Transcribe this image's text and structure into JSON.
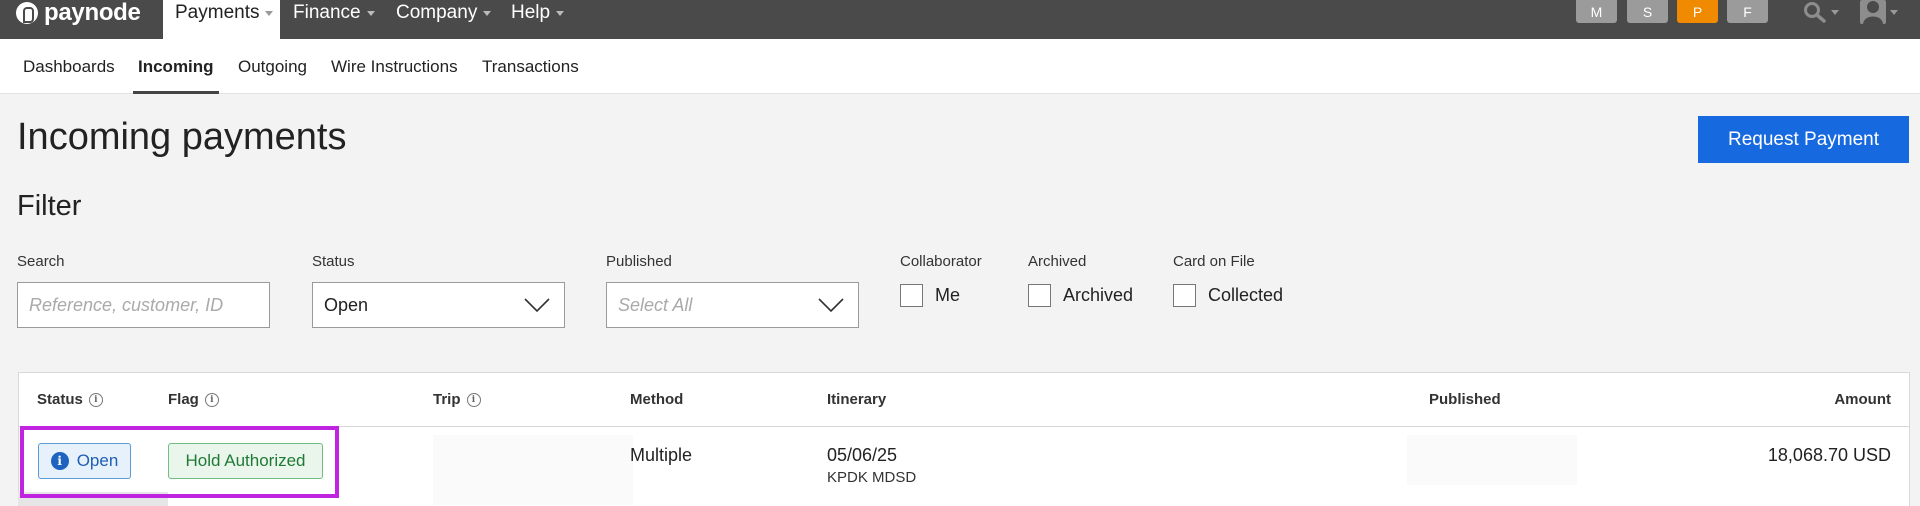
{
  "app": {
    "name": "paynode"
  },
  "topnav": {
    "items": [
      {
        "label": "Payments",
        "active": true
      },
      {
        "label": "Finance",
        "active": false
      },
      {
        "label": "Company",
        "active": false
      },
      {
        "label": "Help",
        "active": false
      }
    ],
    "avatars": [
      {
        "letter": "M",
        "color": "#9b9b9b"
      },
      {
        "letter": "S",
        "color": "#9b9b9b"
      },
      {
        "letter": "P",
        "color": "#f08a00"
      },
      {
        "letter": "F",
        "color": "#9b9b9b"
      }
    ],
    "icons": [
      "search-icon",
      "user-icon"
    ]
  },
  "subnav": {
    "tabs": [
      {
        "label": "Dashboards",
        "active": false
      },
      {
        "label": "Incoming",
        "active": true
      },
      {
        "label": "Outgoing",
        "active": false
      },
      {
        "label": "Wire Instructions",
        "active": false
      },
      {
        "label": "Transactions",
        "active": false
      }
    ]
  },
  "page": {
    "title": "Incoming payments",
    "request_button": "Request Payment",
    "accent": "#1769e0"
  },
  "filter": {
    "title": "Filter",
    "search": {
      "label": "Search",
      "placeholder": "Reference, customer, ID",
      "value": ""
    },
    "status": {
      "label": "Status",
      "value": "Open"
    },
    "published": {
      "label": "Published",
      "placeholder": "Select All"
    },
    "collaborator": {
      "label": "Collaborator",
      "option": "Me",
      "checked": false
    },
    "archived": {
      "label": "Archived",
      "option": "Archived",
      "checked": false
    },
    "card_on_file": {
      "label": "Card on File",
      "option": "Collected",
      "checked": false
    }
  },
  "table": {
    "columns": [
      "Status",
      "Flag",
      "Trip",
      "Method",
      "Itinerary",
      "Published",
      "Amount"
    ],
    "rows": [
      {
        "status": "Open",
        "flag": "Hold Authorized",
        "method": "Multiple",
        "itinerary_date": "05/06/25",
        "itinerary_route": "KPDK MDSD",
        "amount": "18,068.70 USD"
      }
    ]
  },
  "colors": {
    "topnav_bg": "#4a4a4a",
    "status_open": "#1e63c0",
    "flag_green": "#1f7a35",
    "highlight": "#c024e0"
  }
}
